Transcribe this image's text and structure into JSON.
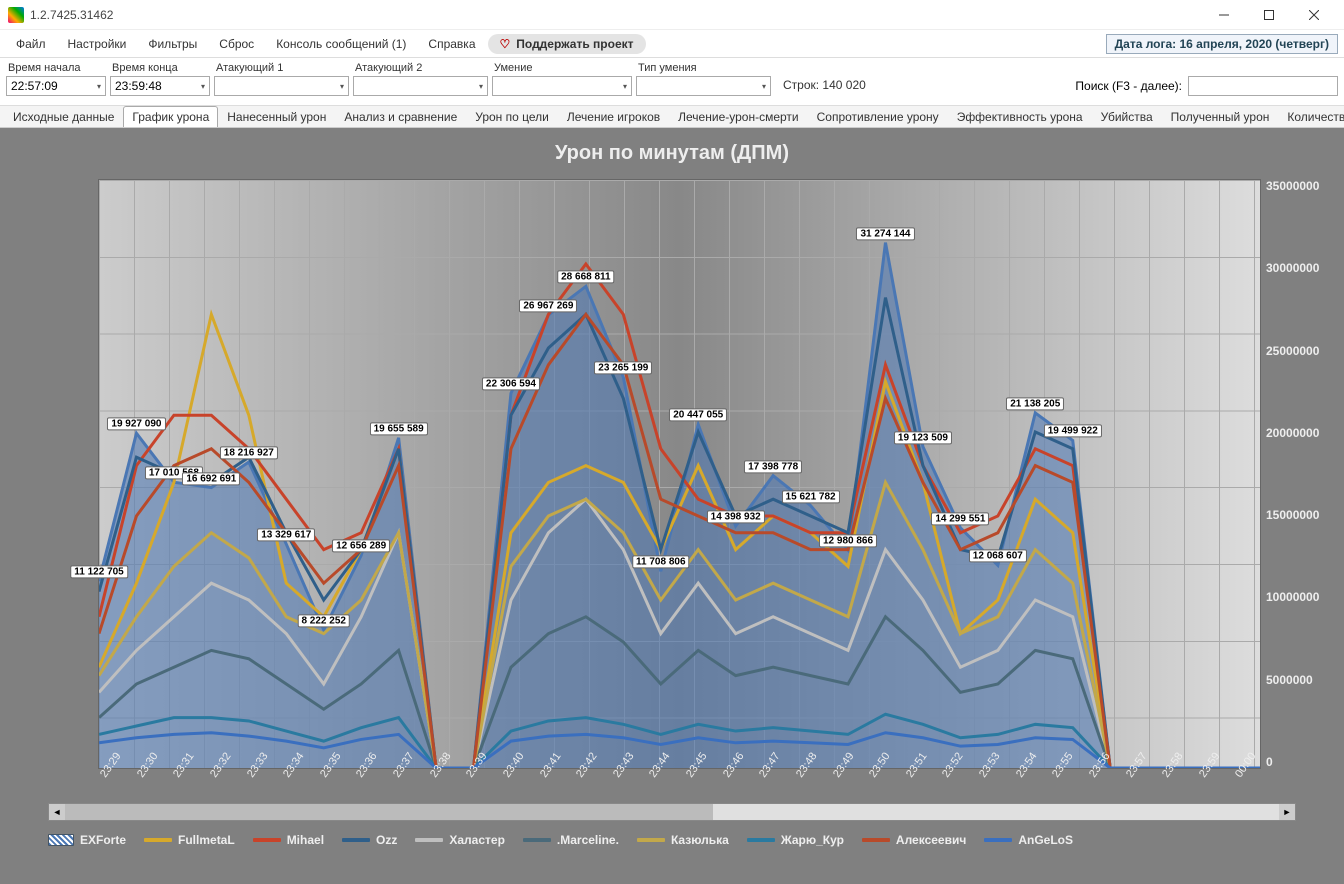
{
  "window": {
    "title": "1.2.7425.31462"
  },
  "menu": {
    "file": "Файл",
    "settings": "Настройки",
    "filters": "Фильтры",
    "reset": "Сброс",
    "console": "Консоль сообщений (1)",
    "help": "Справка",
    "support": "Поддержать проект",
    "logdate": "Дата лога: 16 апреля, 2020  (четверг)"
  },
  "filters": {
    "start_label": "Время начала",
    "start": "22:57:09",
    "end_label": "Время конца",
    "end": "23:59:48",
    "att1_label": "Атакующий 1",
    "att2_label": "Атакующий 2",
    "skill_label": "Умение",
    "skilltype_label": "Тип умения",
    "rows": "Строк: 140 020",
    "search_label": "Поиск (F3 - далее):"
  },
  "tabs": [
    "Исходные данные",
    "График урона",
    "Нанесенный урон",
    "Анализ и сравнение",
    "Урон по цели",
    "Лечение игроков",
    "Лечение-урон-смерти",
    "Сопротивление урону",
    "Эффективность урона",
    "Убийства",
    "Полученный урон",
    "Количество действий игрока"
  ],
  "active_tab": 1,
  "chart_data": {
    "type": "line",
    "title": "Урон по минутам (ДПМ)",
    "ylabel": "",
    "xlabel": "",
    "ylim": [
      0,
      35000000
    ],
    "yticks": [
      0,
      5000000,
      10000000,
      15000000,
      20000000,
      25000000,
      30000000,
      35000000
    ],
    "x": [
      "23:29",
      "23:30",
      "23:31",
      "23:32",
      "23:33",
      "23:34",
      "23:35",
      "23:36",
      "23:37",
      "23:38",
      "23:39",
      "23:40",
      "23:41",
      "23:42",
      "23:43",
      "23:44",
      "23:45",
      "23:46",
      "23:47",
      "23:48",
      "23:49",
      "23:50",
      "23:51",
      "23:52",
      "23:53",
      "23:54",
      "23:55",
      "23:56",
      "23:57",
      "23:58",
      "23:59",
      "00:00"
    ],
    "series": [
      {
        "name": "EXForte",
        "color": "#4a77b4",
        "fill": true,
        "values": [
          11122705,
          19927090,
          17010568,
          16692691,
          18216927,
          13329617,
          8222252,
          12656289,
          19655589,
          0,
          0,
          22306594,
          26967269,
          28668811,
          23265199,
          11708806,
          20447055,
          14398932,
          17398778,
          15621782,
          12980866,
          31274144,
          19123509,
          14299551,
          12068607,
          21138205,
          19499922,
          0,
          0,
          0,
          0,
          0
        ]
      },
      {
        "name": "FullmetaL",
        "color": "#d6a92b",
        "values": [
          6000000,
          11000000,
          17000000,
          27000000,
          21000000,
          11000000,
          9000000,
          13000000,
          19000000,
          0,
          0,
          14000000,
          17000000,
          18000000,
          17000000,
          13000000,
          18000000,
          13000000,
          15000000,
          14000000,
          12000000,
          23000000,
          17000000,
          8000000,
          10000000,
          16000000,
          14000000,
          0,
          0,
          0,
          0,
          0
        ]
      },
      {
        "name": "Mihael",
        "color": "#c8432a",
        "values": [
          9000000,
          18000000,
          21000000,
          21000000,
          19000000,
          16000000,
          13000000,
          14000000,
          19000000,
          0,
          0,
          21000000,
          27000000,
          30000000,
          27000000,
          19000000,
          16000000,
          15000000,
          15000000,
          14000000,
          14000000,
          24000000,
          18000000,
          14000000,
          15000000,
          19000000,
          18000000,
          0,
          0,
          0,
          0,
          0
        ]
      },
      {
        "name": "Ozz",
        "color": "#2f5f8a",
        "values": [
          10500000,
          18500000,
          17500000,
          17000000,
          18500000,
          14000000,
          10000000,
          13000000,
          19000000,
          0,
          0,
          21000000,
          25000000,
          27000000,
          22000000,
          13000000,
          20000000,
          15000000,
          16000000,
          15000000,
          14000000,
          28000000,
          18000000,
          13000000,
          12500000,
          20000000,
          19000000,
          0,
          0,
          0,
          0,
          0
        ]
      },
      {
        "name": "Халастер",
        "color": "#bfbfbf",
        "values": [
          4500000,
          7000000,
          9000000,
          11000000,
          10000000,
          8000000,
          5000000,
          9000000,
          14000000,
          0,
          0,
          10000000,
          14000000,
          16000000,
          13000000,
          8000000,
          11000000,
          8000000,
          9000000,
          8000000,
          7000000,
          13000000,
          10000000,
          6000000,
          7000000,
          10000000,
          9000000,
          0,
          0,
          0,
          0,
          0
        ]
      },
      {
        "name": ".Marceline.",
        "color": "#4a6a7a",
        "values": [
          3000000,
          5000000,
          6000000,
          7000000,
          6500000,
          5000000,
          3500000,
          5000000,
          7000000,
          0,
          0,
          6000000,
          8000000,
          9000000,
          7500000,
          5000000,
          7000000,
          5500000,
          6000000,
          5500000,
          5000000,
          9000000,
          7000000,
          4500000,
          5000000,
          7000000,
          6500000,
          0,
          0,
          0,
          0,
          0
        ]
      },
      {
        "name": "Казюлька",
        "color": "#c2a84a",
        "values": [
          5500000,
          9000000,
          12000000,
          14000000,
          12500000,
          9000000,
          8000000,
          10000000,
          14000000,
          0,
          0,
          12000000,
          15000000,
          16000000,
          14000000,
          10000000,
          13000000,
          10000000,
          11000000,
          10000000,
          9000000,
          17000000,
          13000000,
          8000000,
          9000000,
          13000000,
          11000000,
          0,
          0,
          0,
          0,
          0
        ]
      },
      {
        "name": "Жарю_Кур",
        "color": "#2a7aa0",
        "values": [
          2000000,
          2500000,
          3000000,
          3000000,
          2800000,
          2200000,
          1600000,
          2400000,
          3000000,
          0,
          0,
          2200000,
          2800000,
          3000000,
          2600000,
          2000000,
          2600000,
          2200000,
          2400000,
          2200000,
          2000000,
          3200000,
          2600000,
          1800000,
          2000000,
          2600000,
          2400000,
          0,
          0,
          0,
          0,
          0
        ]
      },
      {
        "name": "Алексеевич",
        "color": "#b84a2a",
        "values": [
          8000000,
          15000000,
          18000000,
          19000000,
          17000000,
          14000000,
          11000000,
          13000000,
          18000000,
          0,
          0,
          19000000,
          24000000,
          27000000,
          24000000,
          16000000,
          15000000,
          14000000,
          14000000,
          13000000,
          13000000,
          22000000,
          17000000,
          13000000,
          14000000,
          18000000,
          17000000,
          0,
          0,
          0,
          0,
          0
        ]
      },
      {
        "name": "AnGeLoS",
        "color": "#3a6fbf",
        "values": [
          1500000,
          1800000,
          2000000,
          2100000,
          1900000,
          1600000,
          1200000,
          1700000,
          2000000,
          0,
          0,
          1600000,
          1900000,
          2000000,
          1800000,
          1400000,
          1800000,
          1500000,
          1600000,
          1500000,
          1400000,
          2100000,
          1800000,
          1300000,
          1400000,
          1800000,
          1700000,
          0,
          0,
          0,
          0,
          0
        ]
      }
    ],
    "labels": [
      {
        "x": 0,
        "v": "11 122 705"
      },
      {
        "x": 1,
        "v": "19 927 090"
      },
      {
        "x": 2,
        "v": "17 010 568"
      },
      {
        "x": 3,
        "v": "16 692 691"
      },
      {
        "x": 4,
        "v": "18 216 927"
      },
      {
        "x": 5,
        "v": "13 329 617"
      },
      {
        "x": 6,
        "v": "8 222 252"
      },
      {
        "x": 7,
        "v": "12 656 289"
      },
      {
        "x": 8,
        "v": "19 655 589"
      },
      {
        "x": 11,
        "v": "22 306 594"
      },
      {
        "x": 12,
        "v": "26 967 269"
      },
      {
        "x": 13,
        "v": "28 668 811"
      },
      {
        "x": 14,
        "v": "23 265 199"
      },
      {
        "x": 15,
        "v": "11 708 806"
      },
      {
        "x": 16,
        "v": "20 447 055"
      },
      {
        "x": 17,
        "v": "14 398 932"
      },
      {
        "x": 18,
        "v": "17 398 778"
      },
      {
        "x": 19,
        "v": "15 621 782"
      },
      {
        "x": 20,
        "v": "12 980 866"
      },
      {
        "x": 21,
        "v": "31 274 144"
      },
      {
        "x": 22,
        "v": "19 123 509"
      },
      {
        "x": 23,
        "v": "14 299 551"
      },
      {
        "x": 24,
        "v": "12 068 607"
      },
      {
        "x": 25,
        "v": "21 138 205"
      },
      {
        "x": 26,
        "v": "19 499 922"
      }
    ]
  }
}
